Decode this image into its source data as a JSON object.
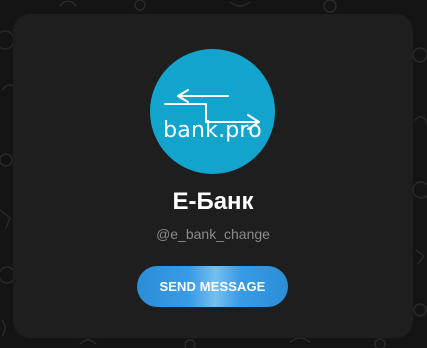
{
  "channel": {
    "logo_text": "bank.pro",
    "name": "Е-Банк",
    "username": "@e_bank_change"
  },
  "actions": {
    "send_message_label": "SEND MESSAGE"
  },
  "colors": {
    "background": "#141414",
    "card": "#1e1e1e",
    "avatar": "#13a4cd",
    "button": "#3a9be5",
    "username": "#8b8b8b"
  },
  "icons": {
    "avatar_arrows": "exchange-arrows-icon"
  }
}
